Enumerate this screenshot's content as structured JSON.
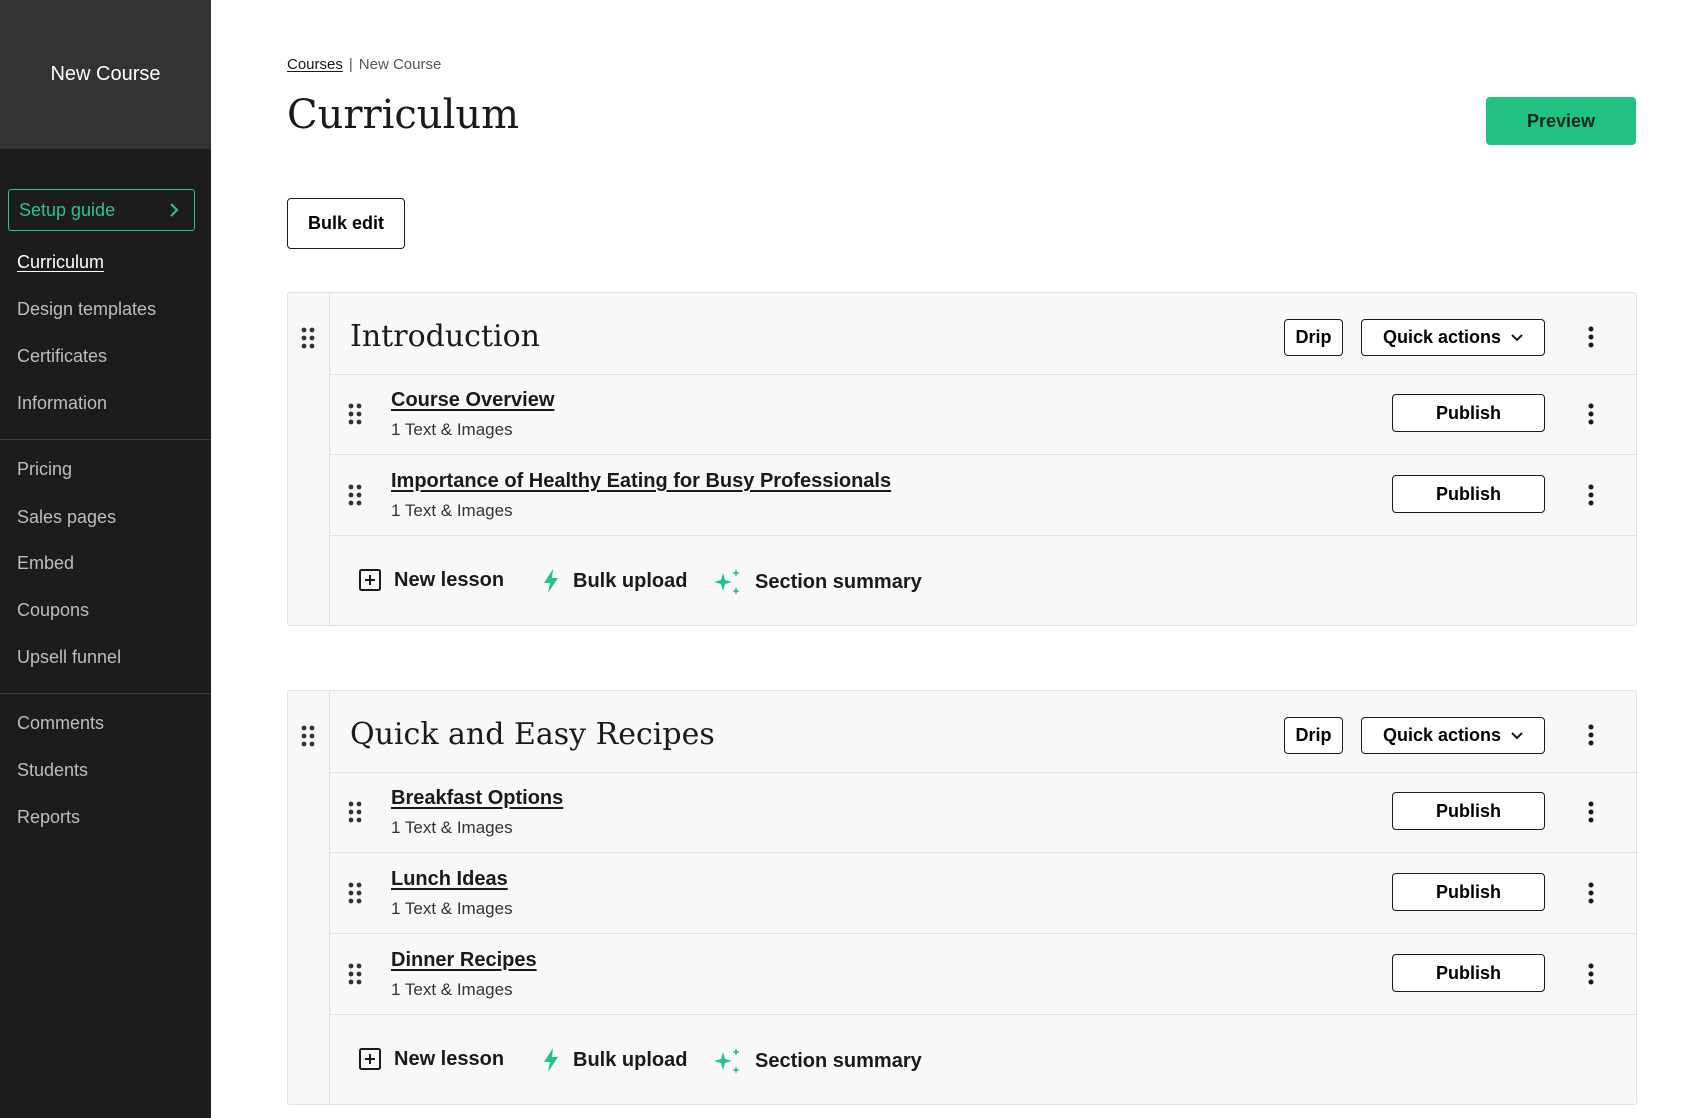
{
  "sidebar": {
    "course_title": "New Course",
    "setup_guide": "Setup guide",
    "nav_groups": [
      [
        "Curriculum",
        "Design templates",
        "Certificates",
        "Information"
      ],
      [
        "Pricing",
        "Sales pages",
        "Embed",
        "Coupons",
        "Upsell funnel"
      ],
      [
        "Comments",
        "Students",
        "Reports"
      ]
    ],
    "active_item": "Curriculum"
  },
  "breadcrumb": {
    "link": "Courses",
    "separator": "|",
    "current": "New Course"
  },
  "page_title": "Curriculum",
  "preview_label": "Preview",
  "bulk_edit_label": "Bulk edit",
  "section_labels": {
    "drip": "Drip",
    "quick_actions": "Quick actions",
    "publish": "Publish",
    "new_lesson": "New lesson",
    "bulk_upload": "Bulk upload",
    "section_summary": "Section summary"
  },
  "sections": [
    {
      "title": "Introduction",
      "lessons": [
        {
          "title": "Course Overview",
          "meta": "1 Text & Images"
        },
        {
          "title": "Importance of Healthy Eating for Busy Professionals",
          "meta": "1 Text & Images"
        }
      ]
    },
    {
      "title": "Quick and Easy Recipes",
      "lessons": [
        {
          "title": "Breakfast Options",
          "meta": "1 Text & Images"
        },
        {
          "title": "Lunch Ideas",
          "meta": "1 Text & Images"
        },
        {
          "title": "Dinner Recipes",
          "meta": "1 Text & Images"
        }
      ]
    }
  ],
  "colors": {
    "accent_green": "#21c283",
    "sidebar_bg": "#1c1c1c",
    "sidebar_header_bg": "#333333"
  },
  "icons": {
    "drag_handle": "grip-dots-icon",
    "kebab": "more-vertical-icon",
    "new_lesson": "plus-square-icon",
    "bulk_upload": "lightning-bolt-icon",
    "section_summary": "sparkle-icon",
    "chevron": "chevron-right-icon",
    "dropdown": "chevron-down-icon"
  }
}
